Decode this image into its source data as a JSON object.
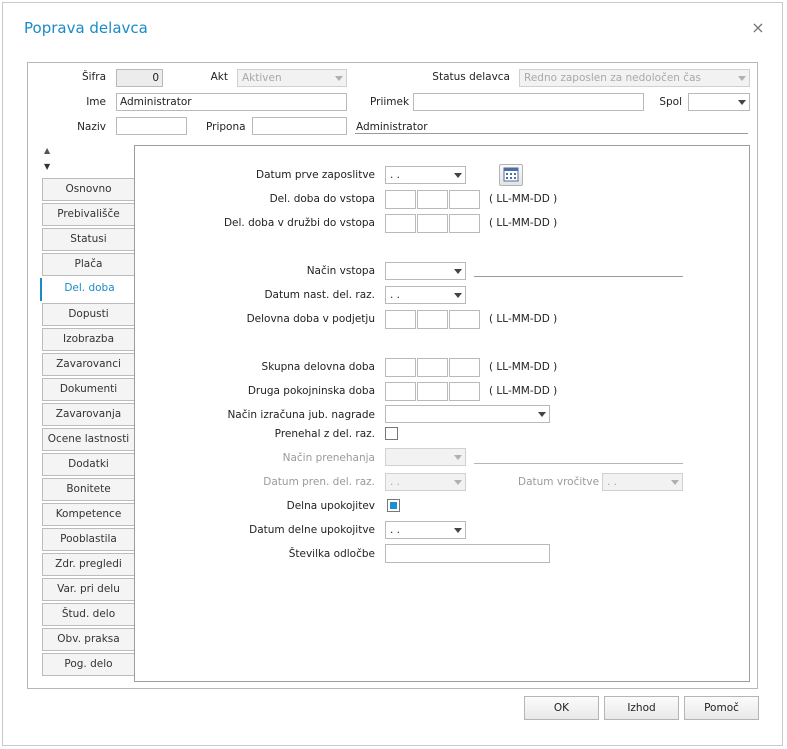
{
  "window": {
    "title": "Poprava delavca",
    "close_glyph": "×"
  },
  "header": {
    "sifra_label": "Šifra",
    "sifra_value": "0",
    "akt_label": "Akt",
    "akt_value": "Aktiven",
    "status_label": "Status delavca",
    "status_value": "Redno zaposlen za nedoločen čas",
    "ime_label": "Ime",
    "ime_value": "Administrator",
    "priimek_label": "Priimek",
    "priimek_value": "",
    "spol_label": "Spol",
    "spol_value": "",
    "naziv_label": "Naziv",
    "naziv_value": "",
    "pripona_label": "Pripona",
    "pripona_value": "",
    "display_name": "Administrator"
  },
  "tabs": {
    "scroll_up": "▲",
    "scroll_down": "▼",
    "items": [
      {
        "label": "Osnovno"
      },
      {
        "label": "Prebivališče"
      },
      {
        "label": "Statusi"
      },
      {
        "label": "Plača"
      },
      {
        "label": "Del. doba"
      },
      {
        "label": "Dopusti"
      },
      {
        "label": "Izobrazba"
      },
      {
        "label": "Zavarovanci"
      },
      {
        "label": "Dokumenti"
      },
      {
        "label": "Zavarovanja"
      },
      {
        "label": "Ocene lastnosti"
      },
      {
        "label": "Dodatki"
      },
      {
        "label": "Bonitete"
      },
      {
        "label": "Kompetence"
      },
      {
        "label": "Pooblastila"
      },
      {
        "label": "Zdr. pregledi"
      },
      {
        "label": "Var. pri delu"
      },
      {
        "label": "Štud. delo"
      },
      {
        "label": "Obv. praksa"
      },
      {
        "label": "Pog. delo"
      }
    ],
    "active": "Del. doba"
  },
  "form": {
    "datum_prve_zaposlitve_label": "Datum prve zaposlitve",
    "datum_prve_zaposlitve_value": ". .",
    "del_doba_do_vstopa_label": "Del. doba do vstopa",
    "del_doba_druzbi_label": "Del. doba v družbi do vstopa",
    "format_hint": "( LL-MM-DD )",
    "nacin_vstopa_label": "Način vstopa",
    "nacin_vstopa_value": "",
    "datum_nast_label": "Datum nast. del. raz.",
    "datum_nast_value": ". .",
    "delovna_doba_podjetju_label": "Delovna doba v podjetju",
    "skupna_delovna_doba_label": "Skupna delovna doba",
    "druga_pokojninska_label": "Druga pokojninska doba",
    "nacin_izracuna_label": "Način izračuna jub. nagrade",
    "nacin_izracuna_value": "",
    "prenehal_label": "Prenehal z del. raz.",
    "prenehal_checked": false,
    "nacin_prenehanja_label": "Način prenehanja",
    "datum_pren_label": "Datum pren. del. raz.",
    "datum_pren_value": ". .",
    "datum_vrocitve_label": "Datum vročitve",
    "datum_vrocitve_value": ". .",
    "delna_upokojitev_label": "Delna upokojitev",
    "delna_upokojitev_checked": true,
    "datum_delne_label": "Datum delne upokojitve",
    "datum_delne_value": ". .",
    "stevilka_odlocbe_label": "Številka odločbe",
    "stevilka_odlocbe_value": ""
  },
  "buttons": {
    "ok": "OK",
    "izhod": "Izhod",
    "pomoc": "Pomoč"
  },
  "colors": {
    "accent": "#1a8bc7",
    "checkbox_fill": "#1e8fd0"
  }
}
